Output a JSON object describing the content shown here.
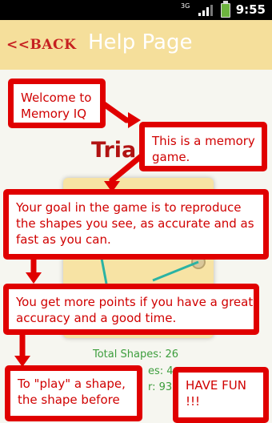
{
  "status": {
    "network": "3G",
    "time": "9:55"
  },
  "header": {
    "back_label": "<<BACK",
    "title": "Help Page"
  },
  "background": {
    "title": "Tria",
    "stats": {
      "total_shapes": "Total Shapes: 26",
      "partial_1": "es: 4",
      "partial_2": "r: 93"
    }
  },
  "bubbles": [
    {
      "text": "Welcome to Memory IQ"
    },
    {
      "text": "This is a memory game."
    },
    {
      "text": "Your goal in the game is to reproduce the shapes you see, as accurate and as fast as you can."
    },
    {
      "text": "You get more points if you have a great accuracy and a good time."
    },
    {
      "text": "To \"play\" a shape, the shape before"
    },
    {
      "text": "HAVE FUN !!!"
    }
  ],
  "colors": {
    "accent_red": "#e00000",
    "header_bg": "#f5df9b",
    "stat_green": "#3d9e3d"
  }
}
